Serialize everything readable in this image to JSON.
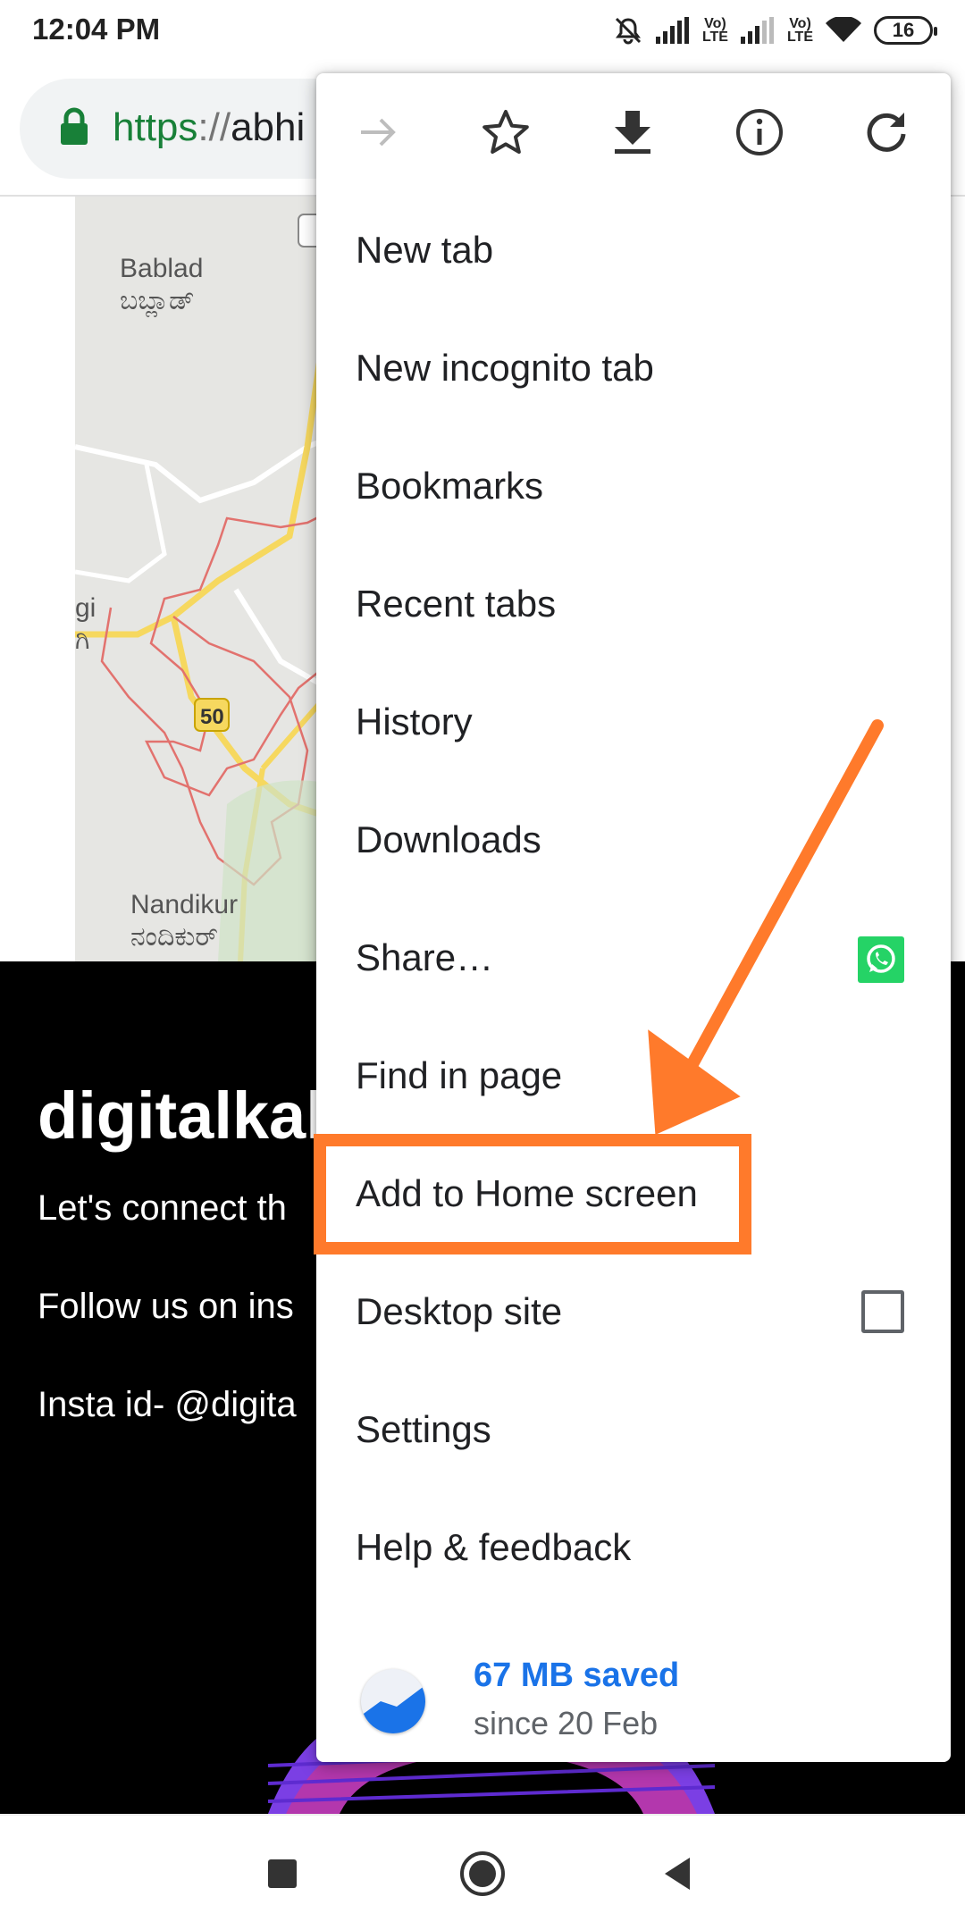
{
  "status_bar": {
    "time": "12:04 PM",
    "battery": "16",
    "lte_1": "Vo) LTE",
    "lte_2": "Vo) LTE",
    "icons": [
      "mute-icon",
      "signal-icon",
      "signal-icon",
      "wifi-icon",
      "battery-icon"
    ]
  },
  "url_bar": {
    "scheme": "https",
    "separator": "://",
    "host": "abhi"
  },
  "page": {
    "map_labels": {
      "bablad": "Bablad",
      "bablad_kannada": "ಬಬ್ಲಾಡ್",
      "nandikur": "Nandikur",
      "nandikur_kannada": "ನಂದಿಕುರ್",
      "road_50": "50",
      "edge_gi": "gi",
      "edge_kn": "ಗಿ"
    },
    "footer": {
      "title": "digitalkal",
      "line1": "Let's connect th",
      "line2": "Follow us on ins",
      "line3": "Insta id- @digita"
    }
  },
  "menu": {
    "top_actions": [
      "forward-icon",
      "bookmark-star-icon",
      "download-icon",
      "info-icon",
      "refresh-icon"
    ],
    "items": [
      {
        "label": "New tab"
      },
      {
        "label": "New incognito tab"
      },
      {
        "label": "Bookmarks"
      },
      {
        "label": "Recent tabs"
      },
      {
        "label": "History"
      },
      {
        "label": "Downloads"
      },
      {
        "label": "Share…",
        "icon": "whatsapp-icon"
      },
      {
        "label": "Find in page"
      },
      {
        "label": "Add to Home screen",
        "highlighted": true
      },
      {
        "label": "Desktop site",
        "checkbox": false
      },
      {
        "label": "Settings"
      },
      {
        "label": "Help & feedback"
      }
    ],
    "data_saver": {
      "amount": "67 MB saved",
      "since": "since 20 Feb"
    }
  },
  "annotation": {
    "color": "#ff7a2b",
    "target": "Add to Home screen"
  },
  "nav_bar": {
    "buttons": [
      "recents-square-icon",
      "home-circle-icon",
      "back-triangle-icon"
    ]
  }
}
